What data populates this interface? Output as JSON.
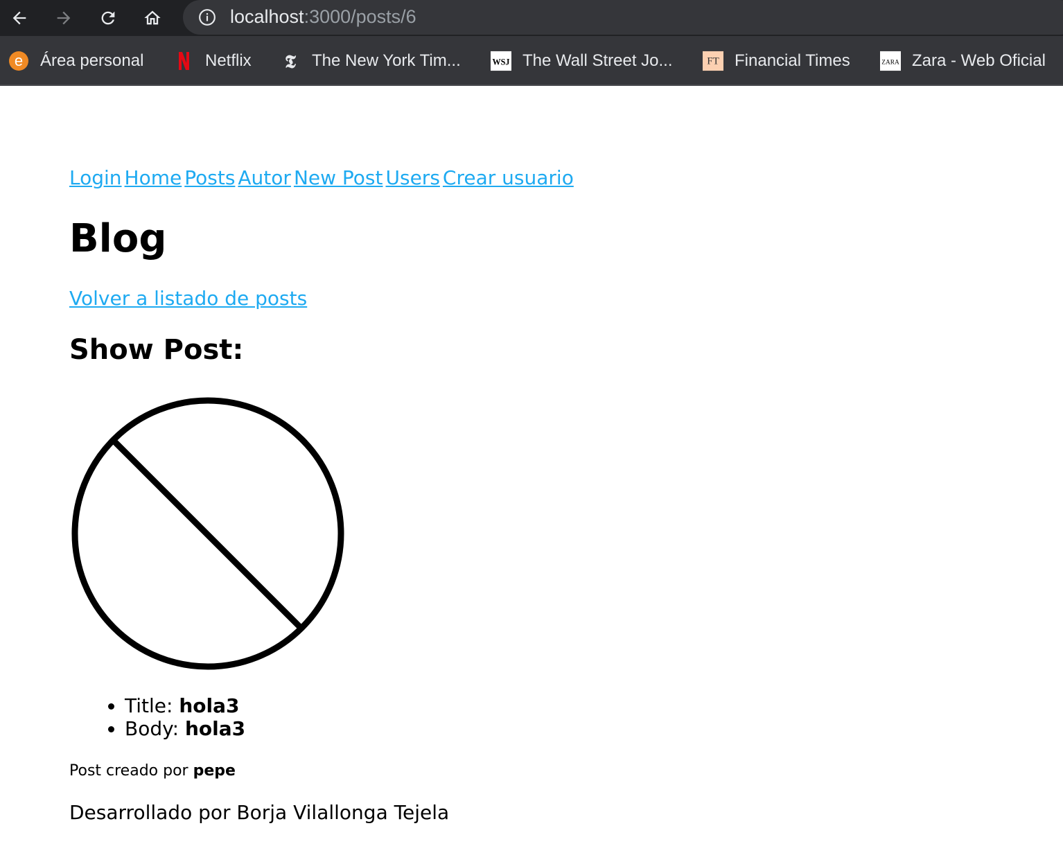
{
  "browser": {
    "url_host": "localhost",
    "url_path": ":3000/posts/6",
    "icons": [
      "back-icon",
      "forward-icon",
      "reload-icon",
      "home-icon",
      "info-icon"
    ],
    "bookmarks": [
      {
        "label": "Área personal",
        "icon": "e-icon"
      },
      {
        "label": "Netflix",
        "icon": "netflix-icon"
      },
      {
        "label": "The New York Tim...",
        "icon": "nyt-icon"
      },
      {
        "label": "The Wall Street Jo...",
        "icon": "wsj-icon"
      },
      {
        "label": "Financial Times",
        "icon": "ft-icon"
      },
      {
        "label": "Zara - Web Oficial",
        "icon": "zara-icon"
      }
    ],
    "bookmark_icon_text": {
      "e": "e",
      "wsj": "WSJ",
      "ft": "FT",
      "zara": "ZARA",
      "nyt": "𝕿"
    }
  },
  "nav": {
    "links": [
      "Login",
      "Home",
      "Posts",
      "Autor",
      "New Post",
      "Users",
      "Crear usuario"
    ]
  },
  "page": {
    "title": "Blog",
    "back_link": "Volver a listado de posts",
    "subtitle": "Show Post:",
    "image_icon": "no-image-icon"
  },
  "post": {
    "title_label": "Title: ",
    "title_value": "hola3",
    "body_label": "Body: ",
    "body_value": "hola3"
  },
  "creator": {
    "prefix": "Post creado por ",
    "name": "pepe"
  },
  "footer": {
    "text": "Desarrollado por Borja Vilallonga Tejela"
  },
  "colors": {
    "link": "#1eaaf1",
    "toolbar": "#202124",
    "bookmarks_bar": "#35363a"
  }
}
